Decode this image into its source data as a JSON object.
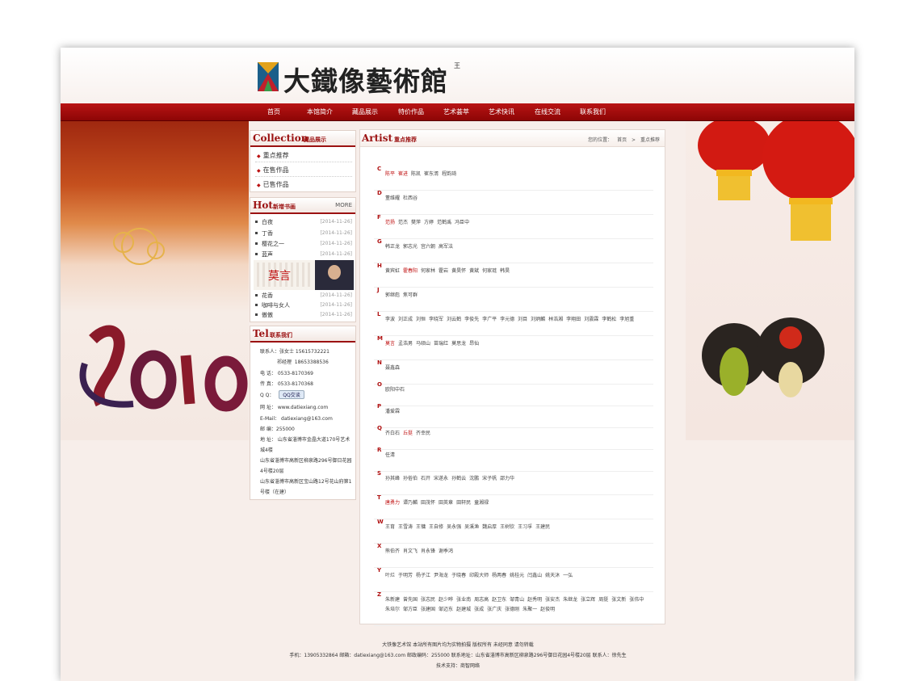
{
  "logo": {
    "title": "大鐵像藝術館",
    "seal": "王"
  },
  "nav": [
    "首页",
    "本馆简介",
    "藏品展示",
    "特价作品",
    "艺术荟萃",
    "艺术快讯",
    "在线交流",
    "联系我们"
  ],
  "collection": {
    "title_en": "Collection",
    "title_cn": "藏品展示",
    "items": [
      "重点推荐",
      "在售作品",
      "已售作品"
    ]
  },
  "hot": {
    "title_en": "Hot",
    "title_cn": "新增书画",
    "more": "MORE",
    "items": [
      {
        "name": "白夜",
        "date": "[2014-11-26]"
      },
      {
        "name": "丁香",
        "date": "[2014-11-26]"
      },
      {
        "name": "樱花之一",
        "date": "[2014-11-26]"
      },
      {
        "name": "蓝声",
        "date": "[2014-11-26]"
      }
    ],
    "banner_text": "莫言",
    "items_after": [
      {
        "name": "花香",
        "date": "[2014-11-26]"
      },
      {
        "name": "咖啡与女人",
        "date": "[2014-11-26]"
      },
      {
        "name": "傲傲",
        "date": "[2014-11-26]"
      }
    ]
  },
  "contact": {
    "title_en": "Tel",
    "title_cn": "联系我们",
    "lines": [
      "联系人：张女士  15615732221",
      "           祁经理  18653388536",
      "电   话：  0533-8170369",
      "传   真：  0533-8170368",
      "Q  Q：",
      "网   址：  www.datiexiang.com",
      "E-Mail：  datiexiang@163.com",
      "邮   编：255000",
      "地   址：  山东省淄博市金晶大道170号艺术",
      "城4楼",
      "山东省淄博市高新区柳泉路296号御日花园",
      "4号楼20层",
      "山东省淄博市高新区宝山路12号花山府第1",
      "号楼（在建）"
    ],
    "qq_label": "QQ交谈"
  },
  "main": {
    "title_en": "Artist",
    "title_cn": "重点推荐",
    "breadcrumb": {
      "label": "您的位置：",
      "home": "首页",
      "sep": ">",
      "current": "重点推荐"
    },
    "letters": [
      {
        "letter": "C",
        "names": [
          "陈平",
          "崔进",
          "陈凯",
          "崔东湑",
          "程韵琦"
        ],
        "hl": [
          0,
          1
        ]
      },
      {
        "letter": "D",
        "names": [
          "董维耀",
          "杜西谷"
        ],
        "hl": []
      },
      {
        "letter": "F",
        "names": [
          "范扬",
          "范杰",
          "樊萍",
          "方婷",
          "范鹤禹",
          "冯臣中"
        ],
        "hl": [
          0
        ]
      },
      {
        "letter": "G",
        "names": [
          "韩正龙",
          "郭志光",
          "宫六朝",
          "高军法"
        ],
        "hl": []
      },
      {
        "letter": "H",
        "names": [
          "黄宾虹",
          "霍春阳",
          "何家林",
          "霍岩",
          "黄昊怀",
          "黄斌",
          "何家琏",
          "韩昊"
        ],
        "hl": [
          1
        ]
      },
      {
        "letter": "J",
        "names": [
          "郭继彪",
          "焦可群"
        ],
        "hl": []
      },
      {
        "letter": "L",
        "names": [
          "李波",
          "刘正成",
          "刘恒",
          "李晓军",
          "刘云鹤",
          "李俊先",
          "李广平",
          "李元德",
          "刘目",
          "刘炳麟",
          "林浩湘",
          "李翔田",
          "刘震霖",
          "李鹤松",
          "李旭重"
        ],
        "hl": []
      },
      {
        "letter": "M",
        "names": [
          "莫言",
          "孟浩男",
          "马硕山",
          "苗瑞红",
          "莫思龙",
          "昂仙"
        ],
        "hl": [
          0
        ]
      },
      {
        "letter": "N",
        "names": [
          "聂鑫森"
        ],
        "hl": []
      },
      {
        "letter": "O",
        "names": [
          "欧阳中石"
        ],
        "hl": []
      },
      {
        "letter": "P",
        "names": [
          "潘爱霖"
        ],
        "hl": []
      },
      {
        "letter": "Q",
        "names": [
          "齐白石",
          "丘挺",
          "齐幸民"
        ],
        "hl": [
          1
        ]
      },
      {
        "letter": "R",
        "names": [
          "任清"
        ],
        "hl": []
      },
      {
        "letter": "S",
        "names": [
          "孙其峰",
          "孙俗伯",
          "石开",
          "宋遂永",
          "孙鹤云",
          "沈鹏",
          "宋子帆",
          "邵力华"
        ],
        "hl": []
      },
      {
        "letter": "T",
        "names": [
          "唐勇力",
          "谭乃麟",
          "田茂怀",
          "田英章",
          "田轩民",
          "童湘禄"
        ],
        "hl": [
          0
        ]
      },
      {
        "letter": "W",
        "names": [
          "王育",
          "王雪涛",
          "王镛",
          "王自修",
          "吴永强",
          "吴溪渔",
          "魏启厚",
          "王树钦",
          "王习孚",
          "王建民"
        ],
        "hl": []
      },
      {
        "letter": "X",
        "names": [
          "熊伯齐",
          "肖文飞",
          "肖永锋",
          "谢季鸿"
        ],
        "hl": []
      },
      {
        "letter": "Y",
        "names": [
          "叶烂",
          "于明芳",
          "杨子江",
          "尹海龙",
          "于晓春",
          "印殿大师",
          "杨两春",
          "姚桂元",
          "闫鑫山",
          "姚天沐",
          "一弘"
        ],
        "hl": []
      },
      {
        "letter": "Z",
        "names": [
          "朱新建",
          "曾先国",
          "张志民",
          "赵少晔",
          "张业南",
          "周志高",
          "赵卫东",
          "邹青山",
          "赵秀明",
          "张安杰",
          "朱继龙",
          "张立辉",
          "周挺",
          "张文新",
          "张伟中",
          "朱培尔",
          "邹方臣",
          "张建国",
          "邹迈东",
          "赵建城",
          "张成",
          "张广庆",
          "张德刚",
          "朱聚一",
          "赵俊明"
        ],
        "hl": []
      }
    ]
  },
  "footer": {
    "line1": "大铁像艺术馆  本站所有图片均为实物拍摄  版权所有 未经同意 请勿转载",
    "line2": "手机：13905332864  邮箱：datiexiang@163.com  邮政编码：255000  联系地址：山东省淄博市高新区柳泉路296号御日花园4号楼20层  联系人：徐先生",
    "line3": "技术支持：商智网络"
  },
  "colors": {
    "brand_red": "#9b1111",
    "nav_red": "#b91414"
  }
}
